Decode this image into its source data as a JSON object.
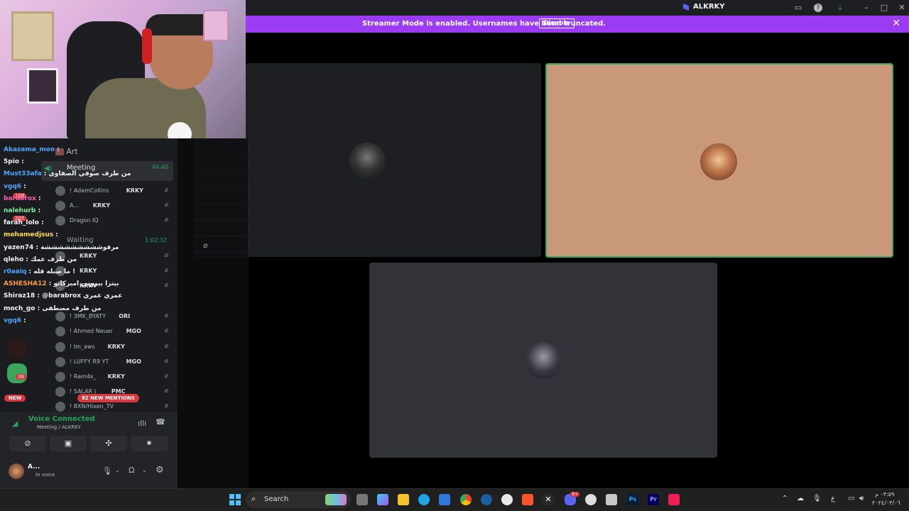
{
  "window": {
    "title": "ALKRKY",
    "banner_text": "Streamer Mode is enabled. Usernames have been truncated.",
    "banner_button": "Disable"
  },
  "sidebar": {
    "art_channel": "Art",
    "meeting_channel": "Meeting",
    "meeting_time": "44:40",
    "waiting_channel": "Waiting",
    "waiting_time": "1:02:32",
    "users": [
      {
        "name": "! AdamCollins",
        "tag": "KRKY"
      },
      {
        "name": "A...",
        "tag": "KRKY"
      },
      {
        "name": "Dragon IQ",
        "tag": ""
      },
      {
        "name": "",
        "tag": "KRKY"
      },
      {
        "name": "",
        "tag": "KRKY"
      },
      {
        "name": "",
        "tag": "KRKY"
      },
      {
        "name": "! 3MK_BYATY",
        "tag": "ORI"
      },
      {
        "name": "! Ahmed Neuer",
        "tag": "MGO"
      },
      {
        "name": "! Im_aws",
        "tag": "KRKY"
      },
      {
        "name": "! LUFFY R9 YT",
        "tag": "MGO"
      },
      {
        "name": "! Ram4x_",
        "tag": "KRKY"
      },
      {
        "name": "! SALAR |",
        "tag": "PMC"
      },
      {
        "name": "! 8XN/Hixen_TV",
        "tag": ""
      }
    ],
    "new_badge": "NEW",
    "mentions_badge": "82 NEW MENTIONS",
    "server_badge": "36",
    "server_badge2": "108",
    "server_badge3": "207"
  },
  "chat": [
    {
      "user": "Akazama_moo",
      "color": "#4aa8ff",
      "text": ""
    },
    {
      "user": "5pio",
      "color": "#f2f3f5",
      "text": ""
    },
    {
      "user": "Must33afa",
      "color": "#4aa8ff",
      "text": "من طرف صوفي الصفاوي"
    },
    {
      "user": "vgq6",
      "color": "#4aa8ff",
      "text": ""
    },
    {
      "user": "barabrox",
      "color": "#ff5bb0",
      "text": ""
    },
    {
      "user": "nalehurb",
      "color": "#7cf29c",
      "text": ""
    },
    {
      "user": "farah_lolo",
      "color": "#f2f3f5",
      "text": ""
    },
    {
      "user": "mohamedjsus",
      "color": "#ffe04a",
      "text": ""
    },
    {
      "user": "yazen74",
      "color": "#f2f3f5",
      "text": "مرفوشششششششششة"
    },
    {
      "user": "qleho",
      "color": "#f2f3f5",
      "text": "من طرف عمك"
    },
    {
      "user": "r0aaiq",
      "color": "#4aa8ff",
      "text": "ما صبله قله !"
    },
    {
      "user": "ASHESHA12",
      "color": "#ff9a3c",
      "text": "بيتزا بيروني اميركانو"
    },
    {
      "user": "Shiraz18",
      "color": "#f2f3f5",
      "text": "@barabrox عمري عمري"
    },
    {
      "user": "moch_go",
      "color": "#f2f3f5",
      "text": "من طرف مصطفى"
    },
    {
      "user": "vgq6",
      "color": "#4aa8ff",
      "text": ""
    }
  ],
  "voice": {
    "status": "Voice Connected",
    "location": "Meeting / ALKRKY",
    "user_name": "A...",
    "user_status": "In voice"
  },
  "taskbar": {
    "search_placeholder": "Search",
    "time": "٠٣:٥٩ م",
    "date": "٢٠٢٤/٠٣/٠٦",
    "lang": "ع",
    "notif_badge": "9+"
  },
  "colors": {
    "banner": "#9b3cf4",
    "speaking_border": "#3ba55d",
    "tile_peach": "#c9977a",
    "tile_dark": "#1e1f22",
    "tile_grey": "#313338",
    "voice_green": "#23a559",
    "new_red": "#da373c"
  }
}
